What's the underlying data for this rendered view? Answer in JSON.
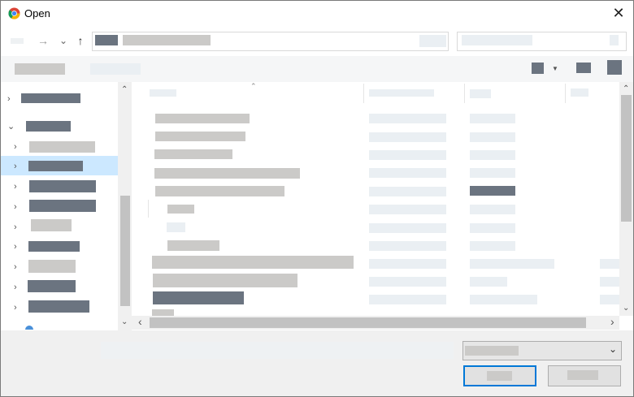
{
  "window": {
    "title": "Open",
    "close_symbol": "✕"
  },
  "nav": {
    "back_symbol": "←",
    "forward_symbol": "→",
    "recent_symbol": "⌄",
    "up_symbol": "↑"
  },
  "colors": {
    "selection": "#cce8ff",
    "primary_border": "#0078d7",
    "redaction_dark": "#6b7480",
    "redaction_gray": "#cbcac8",
    "redaction_light": "#eaeff3"
  },
  "icons": [
    "app-icon",
    "close-icon",
    "back-icon",
    "forward-icon",
    "recent-locations-icon",
    "up-icon",
    "view-icon",
    "dropdown-icon",
    "pane-icon",
    "help-icon",
    "chevron-right-icon",
    "chevron-down-icon"
  ]
}
